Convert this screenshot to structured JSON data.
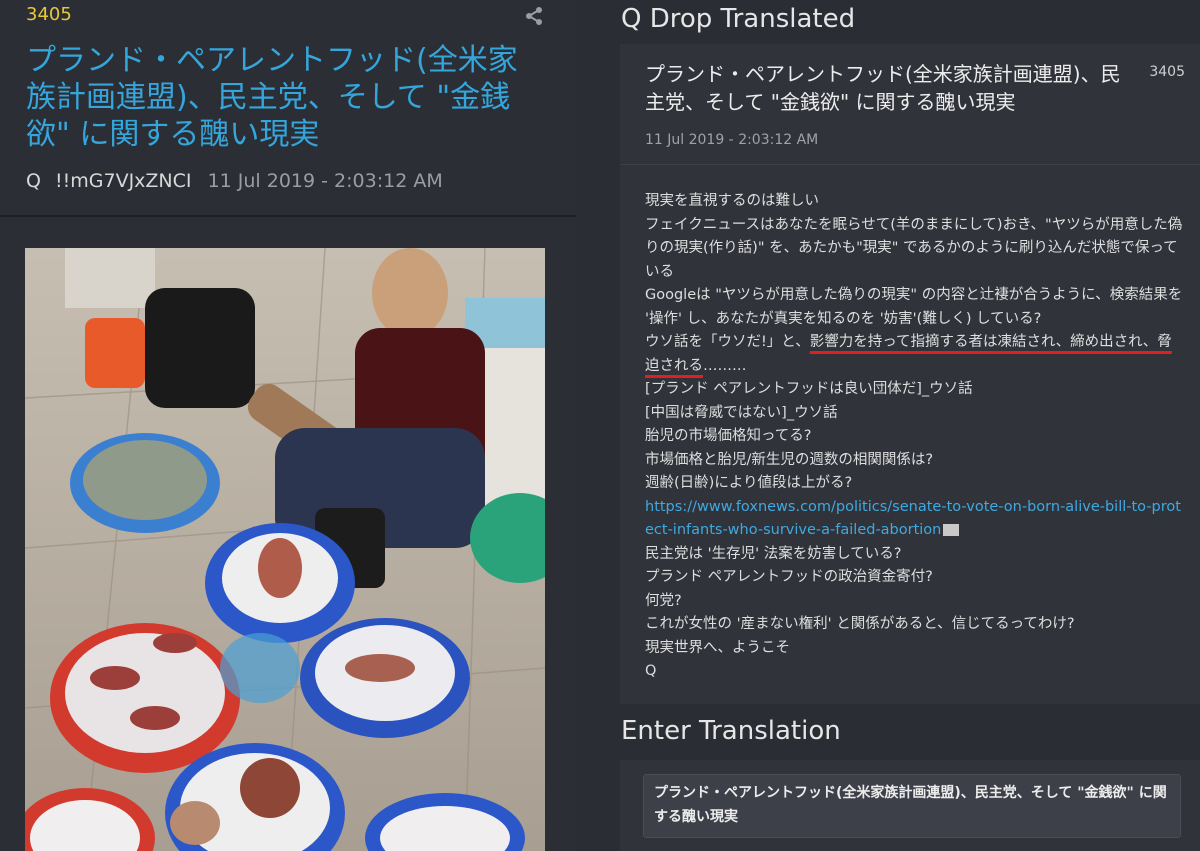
{
  "left": {
    "post_number": "3405",
    "title": "プランド・ペアレントフッド(全米家族計画連盟)、民主党、そして \"金銭欲\" に関する醜い現実",
    "author": "Q",
    "tripcode": "!!mG7VJxZNCI",
    "date": "11 Jul 2019 - 2:03:12 AM"
  },
  "right": {
    "header": "Q Drop Translated",
    "card": {
      "title": "プランド・ペアレントフッド(全米家族計画連盟)、民主党、そして \"金銭欲\" に関する醜い現実",
      "number": "3405",
      "date": "11 Jul 2019 - 2:03:12 AM",
      "lines": [
        "現実を直視するのは難しい",
        "フェイクニュースはあなたを眠らせて(羊のままにして)おき、\"ヤツらが用意した偽りの現実(作り話)\" を、あたかも\"現実\" であるかのように刷り込んだ状態で保っている",
        "Googleは \"ヤツらが用意した偽りの現実\" の内容と辻褄が合うように、検索結果を '操作' し、あなたが真実を知るのを '妨害'(難しく) している?",
        "ウソ話を「ウソだ!」と、",
        "影響力を持って指摘する者は凍結され、締め出され、脅迫される",
        "………",
        "[プランド ペアレントフッドは良い団体だ]_ウソ話",
        "[中国は脅威ではない]_ウソ話",
        "胎児の市場価格知ってる?",
        "市場価格と胎児/新生児の週数の相関関係は?",
        "週齢(日齢)により値段は上がる?",
        "https://www.foxnews.com/politics/senate-to-vote-on-born-alive-bill-to-protect-infants-who-survive-a-failed-abortion",
        "民主党は '生存児' 法案を妨害している?",
        "プランド ペアレントフッドの政治資金寄付?",
        "何党?",
        "これが女性の '産まない権利' と関係があると、信じてるってわけ?",
        "現実世界へ、ようこそ",
        "Q"
      ]
    },
    "enter_header": "Enter Translation",
    "translation_value": "プランド・ペアレントフッド(全米家族計画連盟)、民主党、そして \"金銭欲\" に関する醜い現実"
  },
  "colors": {
    "post_number": "#e7c83a",
    "title_link": "#35a6dc",
    "underline": "#e02020"
  },
  "icons": {
    "share": "share-icon",
    "folder": "folder-icon"
  }
}
